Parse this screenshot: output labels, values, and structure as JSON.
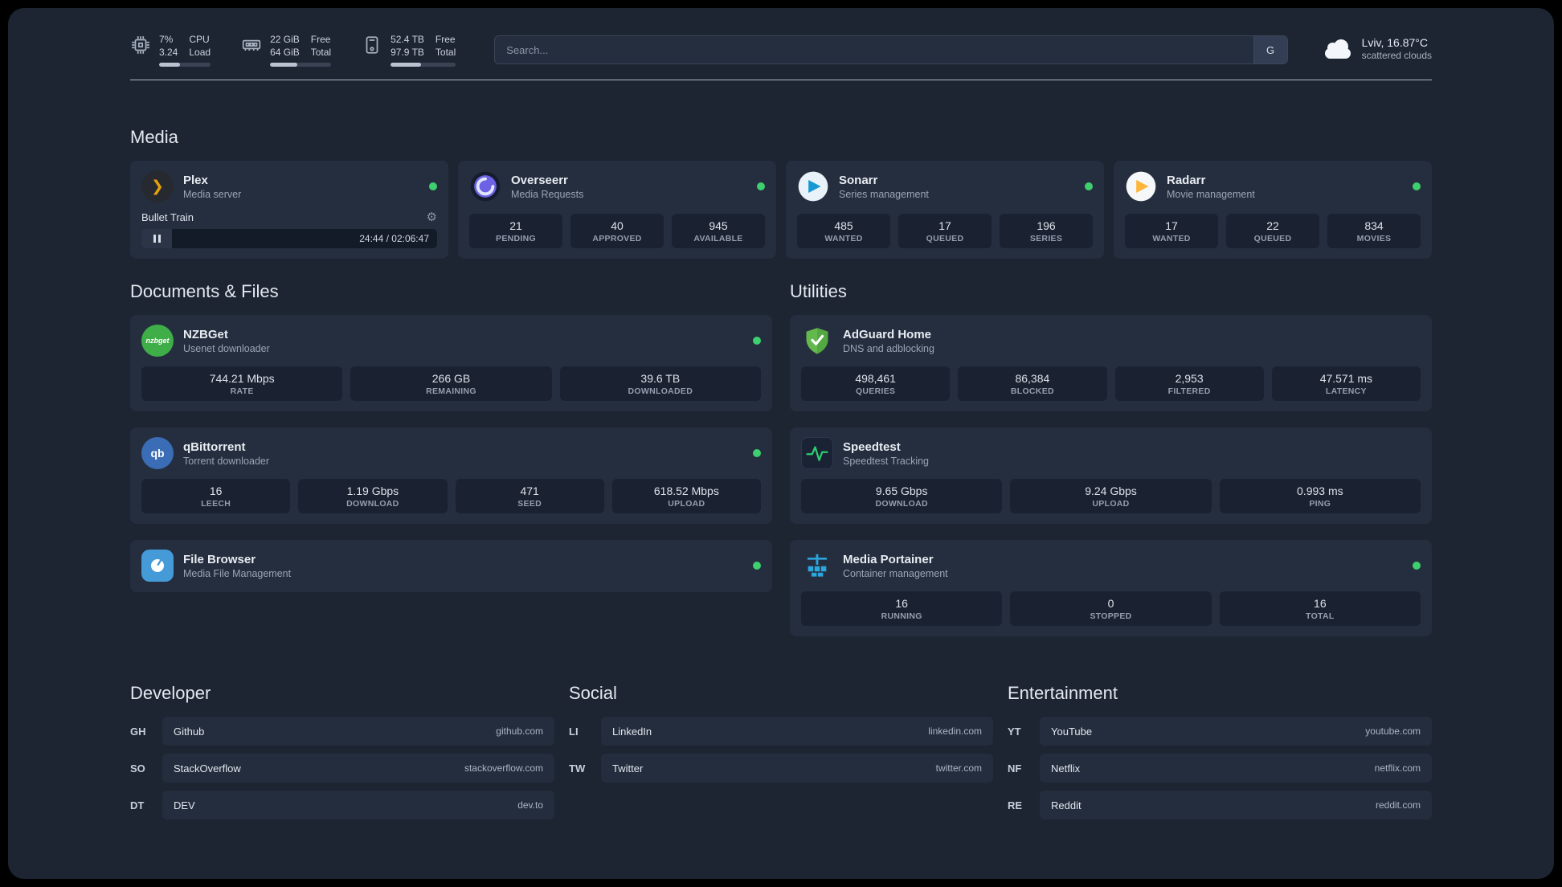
{
  "topbar": {
    "cpu": {
      "icon": "cpu-icon",
      "value_top": "7%",
      "value_bottom": "3.24",
      "label_top": "CPU",
      "label_bottom": "Load",
      "bar_percent": 40
    },
    "memory": {
      "icon": "memory-icon",
      "value_top": "22 GiB",
      "value_bottom": "64 GiB",
      "label_top": "Free",
      "label_bottom": "Total",
      "bar_percent": 44
    },
    "disk": {
      "icon": "disk-icon",
      "value_top": "52.4 TB",
      "value_bottom": "97.9 TB",
      "label_top": "Free",
      "label_bottom": "Total",
      "bar_percent": 47
    },
    "search": {
      "placeholder": "Search...",
      "button_label": "G"
    },
    "weather": {
      "icon": "cloud-icon",
      "location": "Lviv, 16.87°C",
      "condition": "scattered clouds"
    }
  },
  "icons": {
    "gear": "⚙",
    "plex_chevron": "❯",
    "qbittorrent_text": "qb",
    "nzbget_text": "nzbget"
  },
  "colors": {
    "status_online": "#3ecf6f",
    "plex_accent": "#e5a00d"
  },
  "sections": {
    "media": {
      "title": "Media",
      "cards": [
        {
          "icon": "plex-icon",
          "name": "Plex",
          "subtitle": "Media server",
          "status": "online",
          "player": {
            "track": "Bullet Train",
            "time": "24:44 / 02:06:47"
          }
        },
        {
          "icon": "overseerr-icon",
          "name": "Overseerr",
          "subtitle": "Media Requests",
          "status": "online",
          "stats": [
            {
              "value": "21",
              "label": "PENDING"
            },
            {
              "value": "40",
              "label": "APPROVED"
            },
            {
              "value": "945",
              "label": "AVAILABLE"
            }
          ]
        },
        {
          "icon": "sonarr-icon",
          "name": "Sonarr",
          "subtitle": "Series management",
          "status": "online",
          "stats": [
            {
              "value": "485",
              "label": "WANTED"
            },
            {
              "value": "17",
              "label": "QUEUED"
            },
            {
              "value": "196",
              "label": "SERIES"
            }
          ]
        },
        {
          "icon": "radarr-icon",
          "name": "Radarr",
          "subtitle": "Movie management",
          "status": "online",
          "stats": [
            {
              "value": "17",
              "label": "WANTED"
            },
            {
              "value": "22",
              "label": "QUEUED"
            },
            {
              "value": "834",
              "label": "MOVIES"
            }
          ]
        }
      ]
    },
    "documents": {
      "title": "Documents & Files",
      "cards": [
        {
          "icon": "nzbget-icon",
          "name": "NZBGet",
          "subtitle": "Usenet downloader",
          "status": "online",
          "stats": [
            {
              "value": "744.21 Mbps",
              "label": "RATE"
            },
            {
              "value": "266 GB",
              "label": "REMAINING"
            },
            {
              "value": "39.6 TB",
              "label": "DOWNLOADED"
            }
          ]
        },
        {
          "icon": "qbittorrent-icon",
          "name": "qBittorrent",
          "subtitle": "Torrent downloader",
          "status": "online",
          "stats": [
            {
              "value": "16",
              "label": "LEECH"
            },
            {
              "value": "1.19 Gbps",
              "label": "DOWNLOAD"
            },
            {
              "value": "471",
              "label": "SEED"
            },
            {
              "value": "618.52 Mbps",
              "label": "UPLOAD"
            }
          ]
        },
        {
          "icon": "filebrowser-icon",
          "name": "File Browser",
          "subtitle": "Media File Management",
          "status": "online"
        }
      ]
    },
    "utilities": {
      "title": "Utilities",
      "cards": [
        {
          "icon": "adguard-icon",
          "name": "AdGuard Home",
          "subtitle": "DNS and adblocking",
          "stats": [
            {
              "value": "498,461",
              "label": "QUERIES"
            },
            {
              "value": "86,384",
              "label": "BLOCKED"
            },
            {
              "value": "2,953",
              "label": "FILTERED"
            },
            {
              "value": "47.571 ms",
              "label": "LATENCY"
            }
          ]
        },
        {
          "icon": "speedtest-icon",
          "name": "Speedtest",
          "subtitle": "Speedtest Tracking",
          "stats": [
            {
              "value": "9.65 Gbps",
              "label": "DOWNLOAD"
            },
            {
              "value": "9.24 Gbps",
              "label": "UPLOAD"
            },
            {
              "value": "0.993 ms",
              "label": "PING"
            }
          ]
        },
        {
          "icon": "portainer-icon",
          "name": "Media Portainer",
          "subtitle": "Container management",
          "status": "online",
          "stats": [
            {
              "value": "16",
              "label": "RUNNING"
            },
            {
              "value": "0",
              "label": "STOPPED"
            },
            {
              "value": "16",
              "label": "TOTAL"
            }
          ]
        }
      ]
    },
    "bookmarks": [
      {
        "title": "Developer",
        "items": [
          {
            "abbr": "GH",
            "name": "Github",
            "url": "github.com"
          },
          {
            "abbr": "SO",
            "name": "StackOverflow",
            "url": "stackoverflow.com"
          },
          {
            "abbr": "DT",
            "name": "DEV",
            "url": "dev.to"
          }
        ]
      },
      {
        "title": "Social",
        "items": [
          {
            "abbr": "LI",
            "name": "LinkedIn",
            "url": "linkedin.com"
          },
          {
            "abbr": "TW",
            "name": "Twitter",
            "url": "twitter.com"
          }
        ]
      },
      {
        "title": "Entertainment",
        "items": [
          {
            "abbr": "YT",
            "name": "YouTube",
            "url": "youtube.com"
          },
          {
            "abbr": "NF",
            "name": "Netflix",
            "url": "netflix.com"
          },
          {
            "abbr": "RE",
            "name": "Reddit",
            "url": "reddit.com"
          }
        ]
      }
    ]
  }
}
